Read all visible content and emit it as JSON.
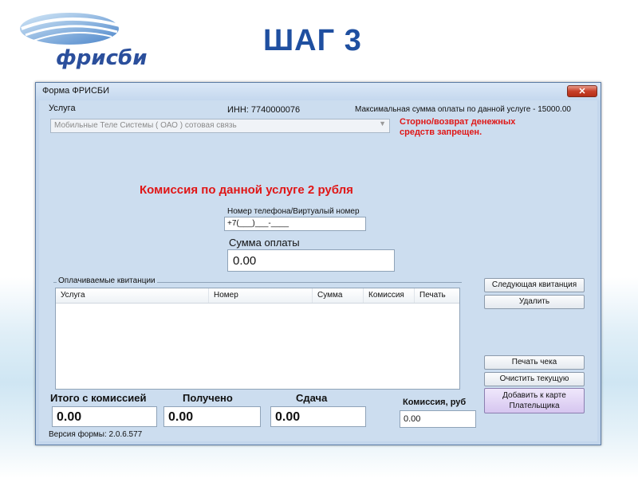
{
  "slide": {
    "logo_text": "фрисби",
    "title": "ШАГ 3"
  },
  "window": {
    "title": "Форма ФРИСБИ",
    "close_glyph": "✕"
  },
  "service": {
    "label": "Услуга",
    "inn": "ИНН: 7740000076",
    "max_amount": "Максимальная сумма оплаты по данной услуге - 15000.00",
    "selected": "Мобильные Теле Системы ( ОАО ) сотовая связь",
    "storno_warning_line1": "Сторно/возврат денежных",
    "storno_warning_line2": "средств запрещен."
  },
  "commission_notice": "Комиссия по данной услуге 2 рубля",
  "phone": {
    "label": "Номер телефона/Виртуалый номер",
    "value": "+7(___)___-____"
  },
  "amount": {
    "label": "Сумма оплаты",
    "value": "0.00"
  },
  "receipts": {
    "group_label": "Оплачиваемые квитанции",
    "columns": [
      "Услуга",
      "Номер",
      "Сумма",
      "Комиссия",
      "Печать"
    ],
    "rows": []
  },
  "buttons": {
    "next_receipt": "Следующая квитанция",
    "delete": "Удалить",
    "print_check": "Печать чека",
    "clear_current": "Очистить текущую",
    "add_card_line1": "Добавить к карте",
    "add_card_line2": "Плательщика"
  },
  "totals": {
    "total_label": "Итого с комиссией",
    "total_value": "0.00",
    "received_label": "Получено",
    "received_value": "0.00",
    "change_label": "Сдача",
    "change_value": "0.00",
    "commission_label": "Комиссия, руб",
    "commission_value": "0.00"
  },
  "version": "Версия формы: 2.0.6.577",
  "colors": {
    "accent_red": "#e01616",
    "title_blue": "#1f4fa0",
    "window_bg": "#ccddef"
  }
}
